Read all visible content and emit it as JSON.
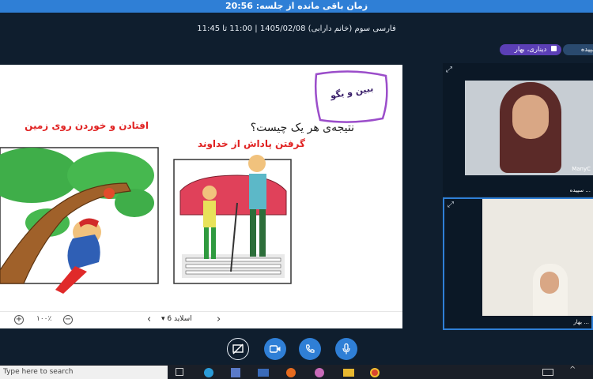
{
  "banner": {
    "text": "زمان باقی مانده از جلسه: 20:56"
  },
  "session": {
    "info": "فارسی سوم (خانم دارابی) 1405/02/08 | 11:00 تا 11:45"
  },
  "participants_tags": [
    {
      "label": "سپیده",
      "color": "#2a4a6e"
    },
    {
      "label": "دیناری، بهار",
      "color": "#5b3fb6"
    }
  ],
  "slide": {
    "badge": "ببین و بگو",
    "question": "نتیجه‌ی هر یک چیست؟",
    "caption_left": "افتادن و خوردن روی زمین",
    "caption_right": "گرفتن پاداش از خداوند"
  },
  "slide_toolbar": {
    "slide_label": "اسلاید 6",
    "zoom": "۱۰۰٪"
  },
  "video": {
    "teacher_name": "... سپیده",
    "teacher_watermark": "ManyC",
    "student_name": "... بهار"
  },
  "controls": {
    "share": "share-off-icon",
    "camera": "camera-icon",
    "phone": "phone-icon",
    "mic": "mic-icon",
    "accent": "#2f7fd6"
  },
  "taskbar": {
    "search_placeholder": "Type here to search"
  }
}
